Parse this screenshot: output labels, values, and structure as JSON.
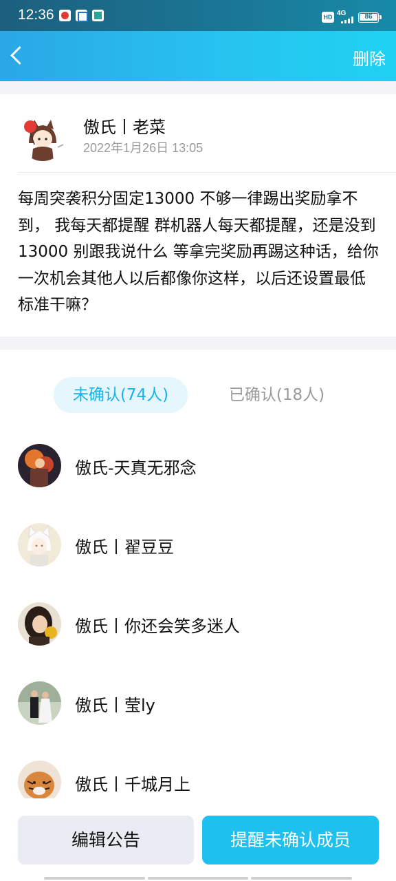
{
  "status_bar": {
    "time": "12:36",
    "hd": "HD",
    "network": "4G",
    "battery": "86"
  },
  "header": {
    "delete_label": "删除"
  },
  "announcement": {
    "author": "傲氏丨老菜",
    "time": "2022年1月26日 13:05",
    "content": "每周突袭积分固定13000 不够一律踢出奖励拿不到， 我每天都提醒 群机器人每天都提醒，还是没到13000 别跟我说什么 等拿完奖励再踢这种话，给你一次机会其他人以后都像你这样，以后还设置最低标准干嘛？"
  },
  "tabs": {
    "unconfirmed": "未确认(74人)",
    "confirmed": "已确认(18人)"
  },
  "members": [
    {
      "name": "傲氏-天真无邪念"
    },
    {
      "name": "傲氏丨翟豆豆"
    },
    {
      "name": "傲氏丨你还会笑多迷人"
    },
    {
      "name": "傲氏丨莹ly"
    },
    {
      "name": "傲氏丨千城月上"
    }
  ],
  "actions": {
    "edit_label": "编辑公告",
    "remind_label": "提醒未确认成员"
  },
  "colors": {
    "accent": "#1ec0ee",
    "header_gradient_start": "#2aa7e6",
    "header_gradient_end": "#1fd2f2"
  }
}
